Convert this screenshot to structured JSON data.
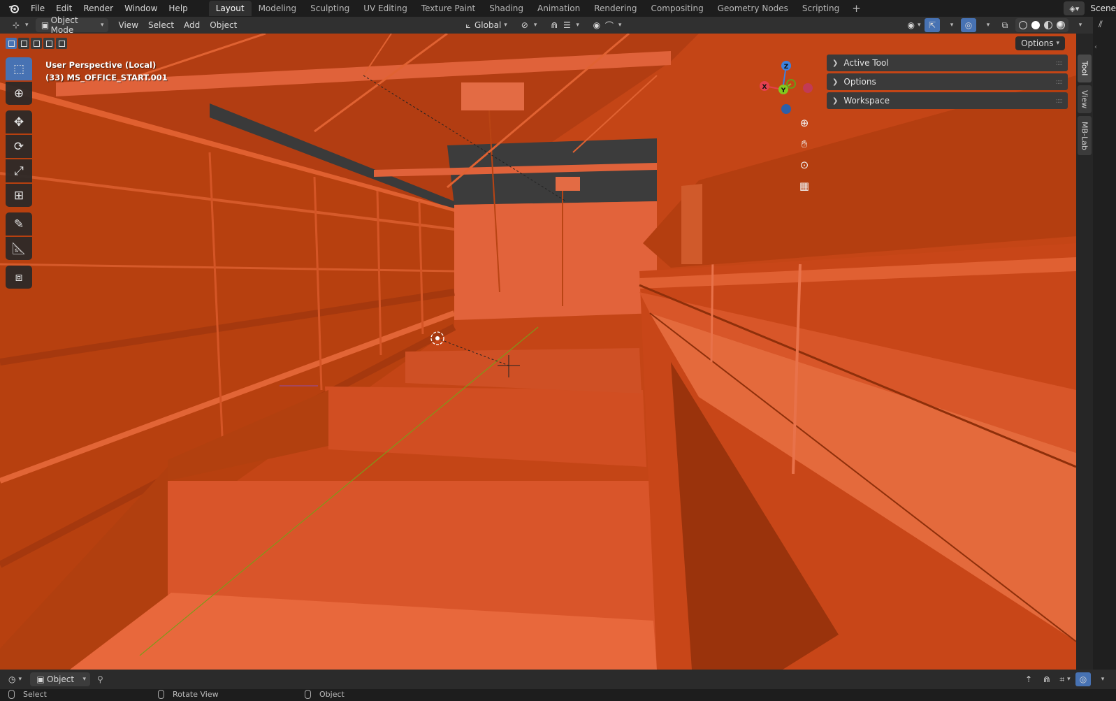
{
  "app": {
    "menus": [
      "File",
      "Edit",
      "Render",
      "Window",
      "Help"
    ],
    "workspaces": [
      "Layout",
      "Modeling",
      "Sculpting",
      "UV Editing",
      "Texture Paint",
      "Shading",
      "Animation",
      "Rendering",
      "Compositing",
      "Geometry Nodes",
      "Scripting"
    ],
    "active_workspace": "Layout",
    "scene_label": "Scene"
  },
  "header": {
    "mode": "Object Mode",
    "menus": [
      "View",
      "Select",
      "Add",
      "Object"
    ],
    "orientation": "Global",
    "options_label": "Options"
  },
  "viewport": {
    "perspective": "User Perspective (Local)",
    "object_info": "(33) MS_OFFICE_START.001",
    "background_color": "#c8481a"
  },
  "gizmo": {
    "x": "X",
    "y": "Y",
    "z": "Z"
  },
  "npanel": {
    "sections": [
      "Active Tool",
      "Options",
      "Workspace"
    ],
    "tabs": [
      "Tool",
      "View",
      "MB-Lab"
    ]
  },
  "timeline": {
    "object_label": "Object"
  },
  "statusbar": {
    "items": [
      "Select",
      "Rotate View",
      "Object"
    ]
  },
  "colors": {
    "accent": "#4772b3",
    "axis_x": "#e5404f",
    "axis_y": "#82c91e",
    "axis_z": "#3d82e0"
  }
}
